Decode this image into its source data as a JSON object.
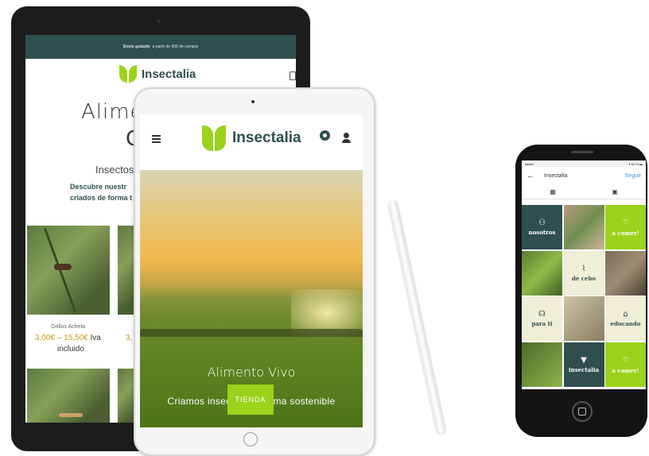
{
  "back_tablet": {
    "banner_bold": "Envío gratuito",
    "banner_text": "a partir de 50€ de compra",
    "logo_text": "Insectalia",
    "heading_line1": "Alime",
    "heading_line2": "C",
    "subtitle": "Insectos v",
    "desc_line1": "Descubre nuestr",
    "desc_line2": "criados de forma t",
    "product": {
      "name": "Grillos Acheta",
      "price_range": "3,00€ – 15,50€",
      "iva": "Iva",
      "included": "incluido",
      "price_partial": "3,"
    }
  },
  "front_tablet": {
    "logo_text": "Insectalia",
    "hero_title": "Alimento Vivo",
    "hero_subtitle": "Criamos insectos de forma sostenible",
    "cta_label": "TIENDA",
    "icons": [
      "menu-icon",
      "cart-icon",
      "user-icon"
    ]
  },
  "phone": {
    "status_left": "●●●●○",
    "status_right": "▾ 63 % ▬",
    "back_glyph": "←",
    "profile_name": "Insectalia",
    "follow_label": "Seguir",
    "tab_grid_glyph": "▦",
    "tab_tagged_glyph": "▣",
    "tiles": [
      {
        "style": "t-dark",
        "icon": "⚇",
        "label": "nosotros"
      },
      {
        "style": "t-photo1",
        "icon": "",
        "label": ""
      },
      {
        "style": "t-lime",
        "icon": "⌔",
        "label": "a comer!"
      },
      {
        "style": "t-photo2",
        "icon": "",
        "label": ""
      },
      {
        "style": "t-cream",
        "icon": "⌇",
        "label": "de cebo"
      },
      {
        "style": "t-photo3",
        "icon": "",
        "label": ""
      },
      {
        "style": "t-cream",
        "icon": "☊",
        "label": "para ti"
      },
      {
        "style": "t-photo4",
        "icon": "",
        "label": ""
      },
      {
        "style": "t-cream",
        "icon": "⌂",
        "label": "educando"
      },
      {
        "style": "t-photo5",
        "icon": "",
        "label": ""
      },
      {
        "style": "t-dark",
        "icon": "▼",
        "label": "insectalia"
      },
      {
        "style": "t-lime",
        "icon": "⌔",
        "label": "a comer!"
      }
    ]
  },
  "colors": {
    "brand_dark": "#2f4f4f",
    "brand_lime": "#9bd21c",
    "price_gold": "#c59b19"
  }
}
